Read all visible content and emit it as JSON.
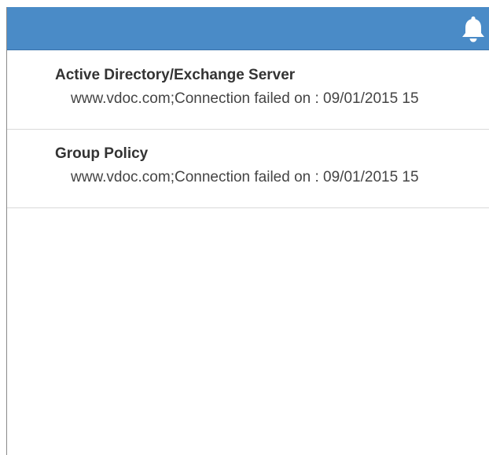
{
  "header": {
    "icon": "bell-icon",
    "color": "#4a8bc7"
  },
  "notifications": [
    {
      "title": "Active Directory/Exchange Server",
      "detail": "www.vdoc.com;Connection failed on : 09/01/2015 15"
    },
    {
      "title": "Group Policy",
      "detail": "www.vdoc.com;Connection failed on : 09/01/2015 15"
    }
  ]
}
